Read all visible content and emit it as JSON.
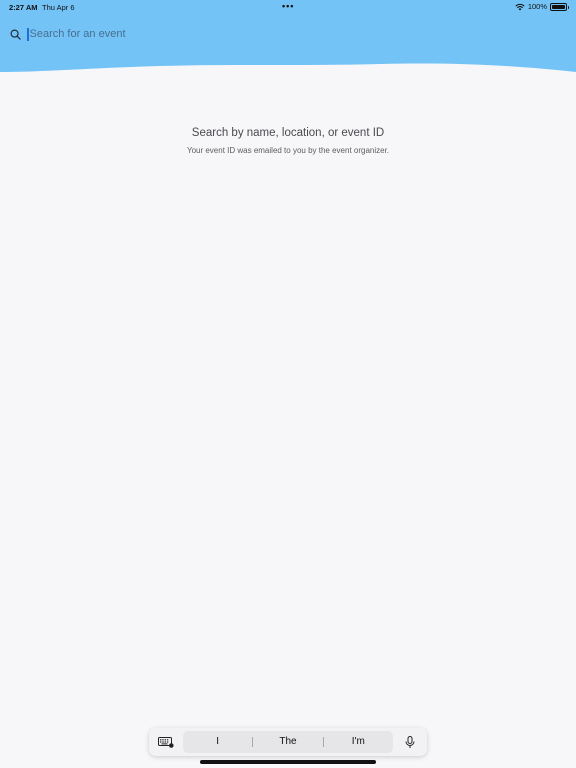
{
  "status_bar": {
    "time": "2:27 AM",
    "date": "Thu Apr 6",
    "dots": "•••",
    "battery": "100%",
    "battery_level": 1.0
  },
  "search": {
    "placeholder": "Search for an event",
    "value": ""
  },
  "empty_state": {
    "title": "Search by name, location, or event ID",
    "subtitle": "Your event ID was emailed to you by the event organizer."
  },
  "keyboard_bar": {
    "suggestions": [
      "I",
      "The",
      "I'm"
    ]
  },
  "colors": {
    "header": "#74c3f7",
    "background": "#f7f7f9",
    "cursor": "#1f6fd6"
  }
}
